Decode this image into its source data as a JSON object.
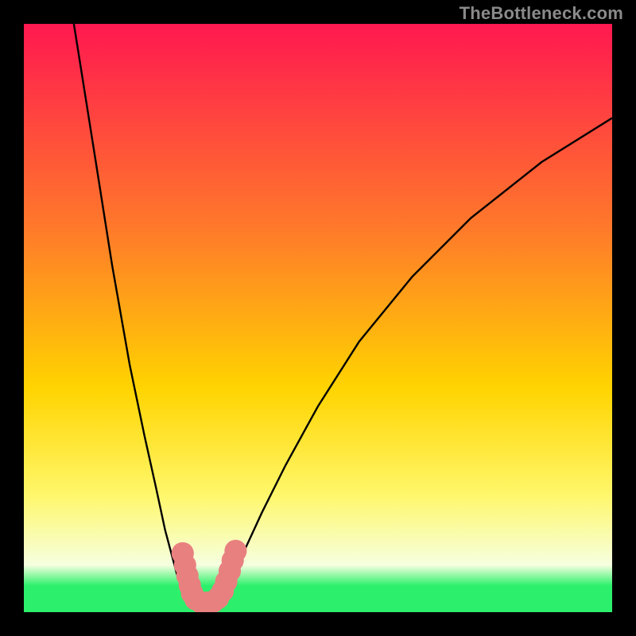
{
  "watermark": "TheBottleneck.com",
  "colors": {
    "frame": "#000000",
    "curve_stroke": "#000000",
    "marker_fill": "#e98080",
    "green_band": "#2cf06b",
    "gradient_top": "#ff1850",
    "gradient_mid_upper": "#ff7a2a",
    "gradient_mid": "#ffd400",
    "gradient_mid_lower": "#fff76a",
    "gradient_pale": "#f6ffe0"
  },
  "chart_data": {
    "type": "line",
    "title": "",
    "xlabel": "",
    "ylabel": "",
    "xlim": [
      0,
      100
    ],
    "ylim": [
      0,
      100
    ],
    "grid": false,
    "legend": false,
    "green_band_y": [
      0,
      4.5
    ],
    "series": [
      {
        "name": "left-branch",
        "x": [
          8.5,
          12,
          15,
          18,
          20.5,
          22.5,
          24,
          25.2,
          26,
          26.6,
          27.2,
          27.8,
          28.5
        ],
        "y": [
          100,
          78,
          59,
          42,
          30,
          21,
          14,
          9.5,
          6.5,
          4.8,
          3.5,
          2.3,
          1.2
        ]
      },
      {
        "name": "valley-floor",
        "x": [
          28.5,
          30,
          31.5,
          33
        ],
        "y": [
          1.2,
          0.6,
          0.6,
          1.2
        ]
      },
      {
        "name": "right-branch",
        "x": [
          33,
          34,
          35.5,
          37.5,
          40.5,
          44.5,
          50,
          57,
          66,
          76,
          88,
          100
        ],
        "y": [
          1.2,
          3,
          6,
          10.5,
          17,
          25,
          35,
          46,
          57,
          67,
          76.5,
          84
        ]
      }
    ],
    "markers": [
      {
        "name": "left-cluster-top",
        "x": 27.0,
        "y": 10.0,
        "r": 1.9
      },
      {
        "name": "left-cluster-upper",
        "x": 27.4,
        "y": 8.0,
        "r": 1.9
      },
      {
        "name": "left-cluster-mid",
        "x": 27.8,
        "y": 6.2,
        "r": 1.9
      },
      {
        "name": "left-cluster-lower",
        "x": 28.2,
        "y": 4.6,
        "r": 1.9
      },
      {
        "name": "left-cluster-bottom",
        "x": 28.6,
        "y": 3.2,
        "r": 1.9
      },
      {
        "name": "valley-left",
        "x": 29.2,
        "y": 2.2,
        "r": 1.9
      },
      {
        "name": "valley-mid-left",
        "x": 30.2,
        "y": 1.6,
        "r": 1.9
      },
      {
        "name": "valley-mid",
        "x": 31.2,
        "y": 1.6,
        "r": 1.9
      },
      {
        "name": "valley-mid-right",
        "x": 32.2,
        "y": 1.8,
        "r": 1.9
      },
      {
        "name": "valley-right",
        "x": 33.0,
        "y": 2.4,
        "r": 1.9
      },
      {
        "name": "right-cluster-lower",
        "x": 33.8,
        "y": 3.6,
        "r": 1.9
      },
      {
        "name": "right-cluster-low",
        "x": 34.4,
        "y": 5.2,
        "r": 1.9
      },
      {
        "name": "right-cluster-mid",
        "x": 35.0,
        "y": 7.0,
        "r": 1.9
      },
      {
        "name": "right-cluster-upper",
        "x": 35.5,
        "y": 8.8,
        "r": 1.9
      },
      {
        "name": "right-cluster-top",
        "x": 36.0,
        "y": 10.4,
        "r": 1.9
      }
    ]
  }
}
